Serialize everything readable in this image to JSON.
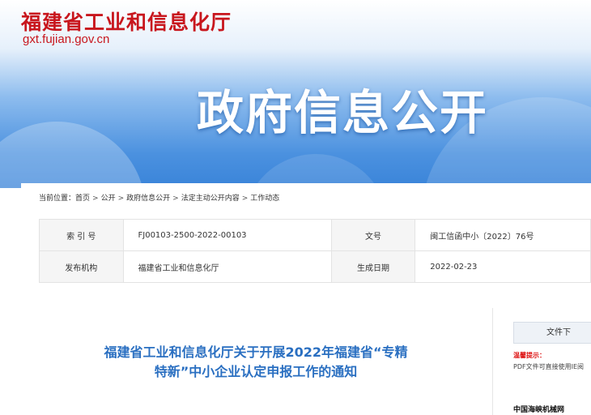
{
  "site": {
    "name": "福建省工业和信息化厅",
    "domain": "gxt.fujian.gov.cn"
  },
  "banner": {
    "title": "政府信息公开"
  },
  "breadcrumb": {
    "label": "当前位置：",
    "items": [
      "首页",
      "公开",
      "政府信息公开",
      "法定主动公开内容",
      "工作动态"
    ]
  },
  "meta": {
    "index_label": "索 引 号",
    "index_value": "FJ00103-2500-2022-00103",
    "docno_label": "文号",
    "docno_value": "闽工信函中小〔2022〕76号",
    "org_label": "发布机构",
    "org_value": "福建省工业和信息化厅",
    "date_label": "生成日期",
    "date_value": "2022-02-23"
  },
  "document": {
    "title": "福建省工业和信息化厅关于开展2022年福建省“专精特新”中小企业认定申报工作的通知"
  },
  "sidebar": {
    "download_label": "文件下",
    "tip_title": "温馨提示：",
    "tip_text": "PDF文件可直接使用IE阅",
    "partner_name": "中国海峡机械网"
  }
}
